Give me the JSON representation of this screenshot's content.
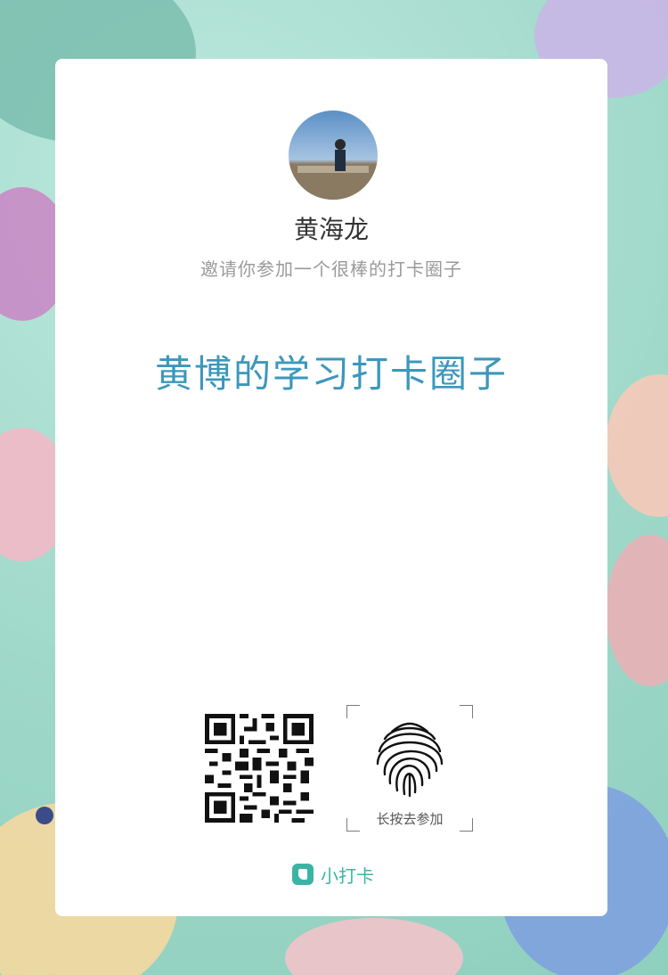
{
  "card": {
    "user_name": "黄海龙",
    "invite_text": "邀请你参加一个很棒的打卡圈子",
    "circle_title": "黄博的学习打卡圈子",
    "fingerprint_label": "长按去参加",
    "brand_name": "小打卡"
  },
  "icons": {
    "avatar": "avatar-photo",
    "qr": "qr-code-icon",
    "fingerprint": "fingerprint-icon",
    "brand": "xiaodaka-logo-icon"
  },
  "colors": {
    "title": "#3c97bb",
    "brand": "#3cb4a4",
    "background": "#a7ddd0"
  }
}
